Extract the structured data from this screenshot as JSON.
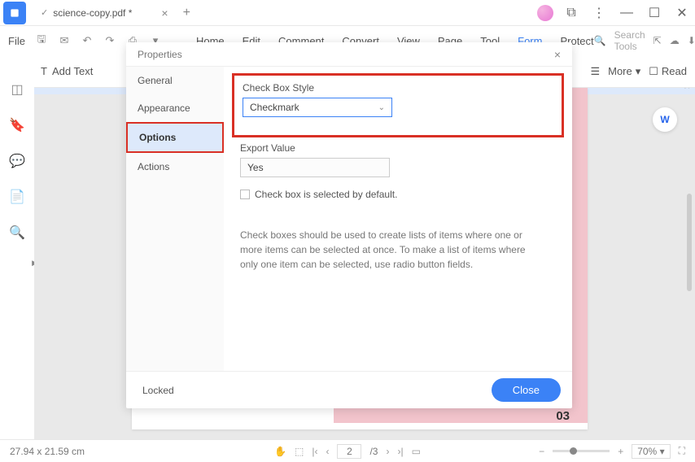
{
  "titlebar": {
    "tab_name": "science-copy.pdf *"
  },
  "menubar": {
    "file": "File",
    "items": [
      "Home",
      "Edit",
      "Comment",
      "Convert",
      "View",
      "Page",
      "Tool",
      "Form",
      "Protect"
    ],
    "search_placeholder": "Search Tools"
  },
  "toolbar": {
    "add_text": "Add Text",
    "more": "More",
    "read": "Read"
  },
  "dialog": {
    "title": "Properties",
    "nav": {
      "general": "General",
      "appearance": "Appearance",
      "options": "Options",
      "actions": "Actions"
    },
    "style_label": "Check Box Style",
    "style_value": "Checkmark",
    "export_label": "Export Value",
    "export_value": "Yes",
    "default_cb": "Check box is selected by default.",
    "help": "Check boxes should be used to create lists of items where one or more items can be selected at once. To make a list of items where only one item can be selected, use radio button fields.",
    "locked": "Locked",
    "close": "Close"
  },
  "page": {
    "number": "03"
  },
  "statusbar": {
    "dims": "27.94 x 21.59 cm",
    "page_current": "2",
    "page_total": "/3",
    "zoom": "70%"
  }
}
